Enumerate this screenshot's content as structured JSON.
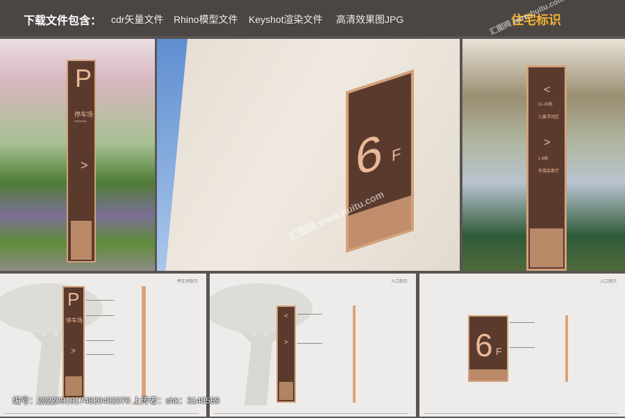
{
  "header": {
    "download_label": "下载文件包含：",
    "formats": [
      "cdr矢量文件",
      "Rhino模型文件",
      "Keyshot渲染文件",
      "高清效果图JPG"
    ],
    "title": "住宅标识"
  },
  "photos": {
    "parking_sign": {
      "letter": "P",
      "label": "停车场",
      "sub": "PARKING",
      "arrow": ">"
    },
    "floor_sign": {
      "number": "6",
      "suffix": "F"
    },
    "hall_sign": {
      "arrow1": "<",
      "range1": "11-20栋",
      "name1": "儿童活动区",
      "arrow2": ">",
      "range2": "1-6栋",
      "name2": "幸福会客厅"
    }
  },
  "drawings": {
    "d1": {
      "header": "停车场指示",
      "letter": "P",
      "label": "停车场",
      "arrow": ">"
    },
    "d2": {
      "header": "入口指示",
      "arrow1": "<",
      "arrow2": ">"
    },
    "d3": {
      "header": "入口指示",
      "number": "6",
      "suffix": "F"
    }
  },
  "footer": {
    "info": "编号：20220919174820402070 上传者：shk：3140569"
  },
  "watermark": {
    "text": "汇图网 www.huitu.com"
  }
}
